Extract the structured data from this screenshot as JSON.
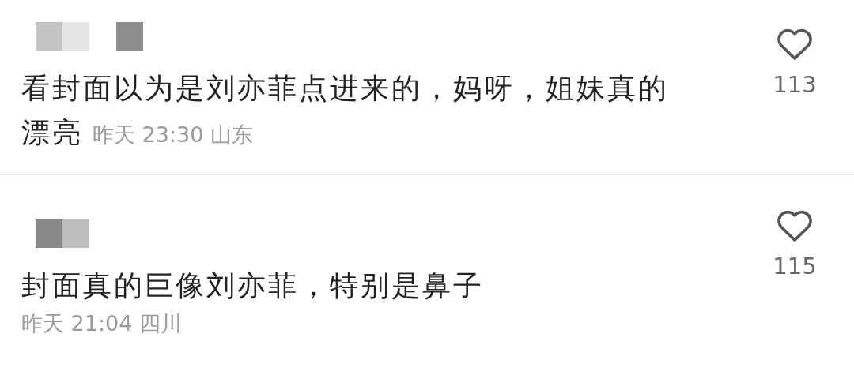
{
  "comments": [
    {
      "name_pixelated": true,
      "text_lines": [
        "看封面以为是刘亦菲点进来的，妈呀，姐妹真的",
        "漂亮"
      ],
      "time": "昨天 23:30",
      "location": "山东",
      "kind": "inline",
      "likes": "113",
      "liked": false
    },
    {
      "name_pixelated": true,
      "text_lines": [
        "封面真的巨像刘亦菲，特别是鼻子"
      ],
      "time": "昨天 21:04",
      "location": "四川",
      "kind": "below",
      "likes": "115",
      "liked": false
    }
  ]
}
